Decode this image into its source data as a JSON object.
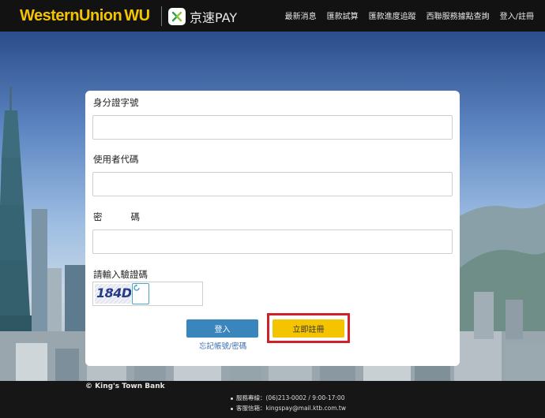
{
  "header": {
    "wu_brand": "WesternUnion",
    "wu_mark": "WU",
    "ktb_name": "京速PAY",
    "nav": [
      "最新消息",
      "匯款試算",
      "匯款進度追蹤",
      "西聯服務據點查詢",
      "登入/註冊"
    ]
  },
  "form": {
    "id_label": "身分證字號",
    "user_code_label": "使用者代碼",
    "password_label_a": "密",
    "password_label_b": "碼",
    "captcha_label": "請輸入驗證碼",
    "captcha_text": "184D",
    "login_label": "登入",
    "forgot_label": "忘記帳號/密碼",
    "register_label": "立即註冊"
  },
  "footer": {
    "copyright": "© King's Town Bank",
    "hotline": "服務專線：(06)213-0002 / 9:00-17:00",
    "email": "客服信箱：kingspay@mail.ktb.com.tw"
  },
  "colors": {
    "brand_yellow": "#f5c400",
    "login_blue": "#3b85bd",
    "highlight_red": "#d0202a"
  }
}
